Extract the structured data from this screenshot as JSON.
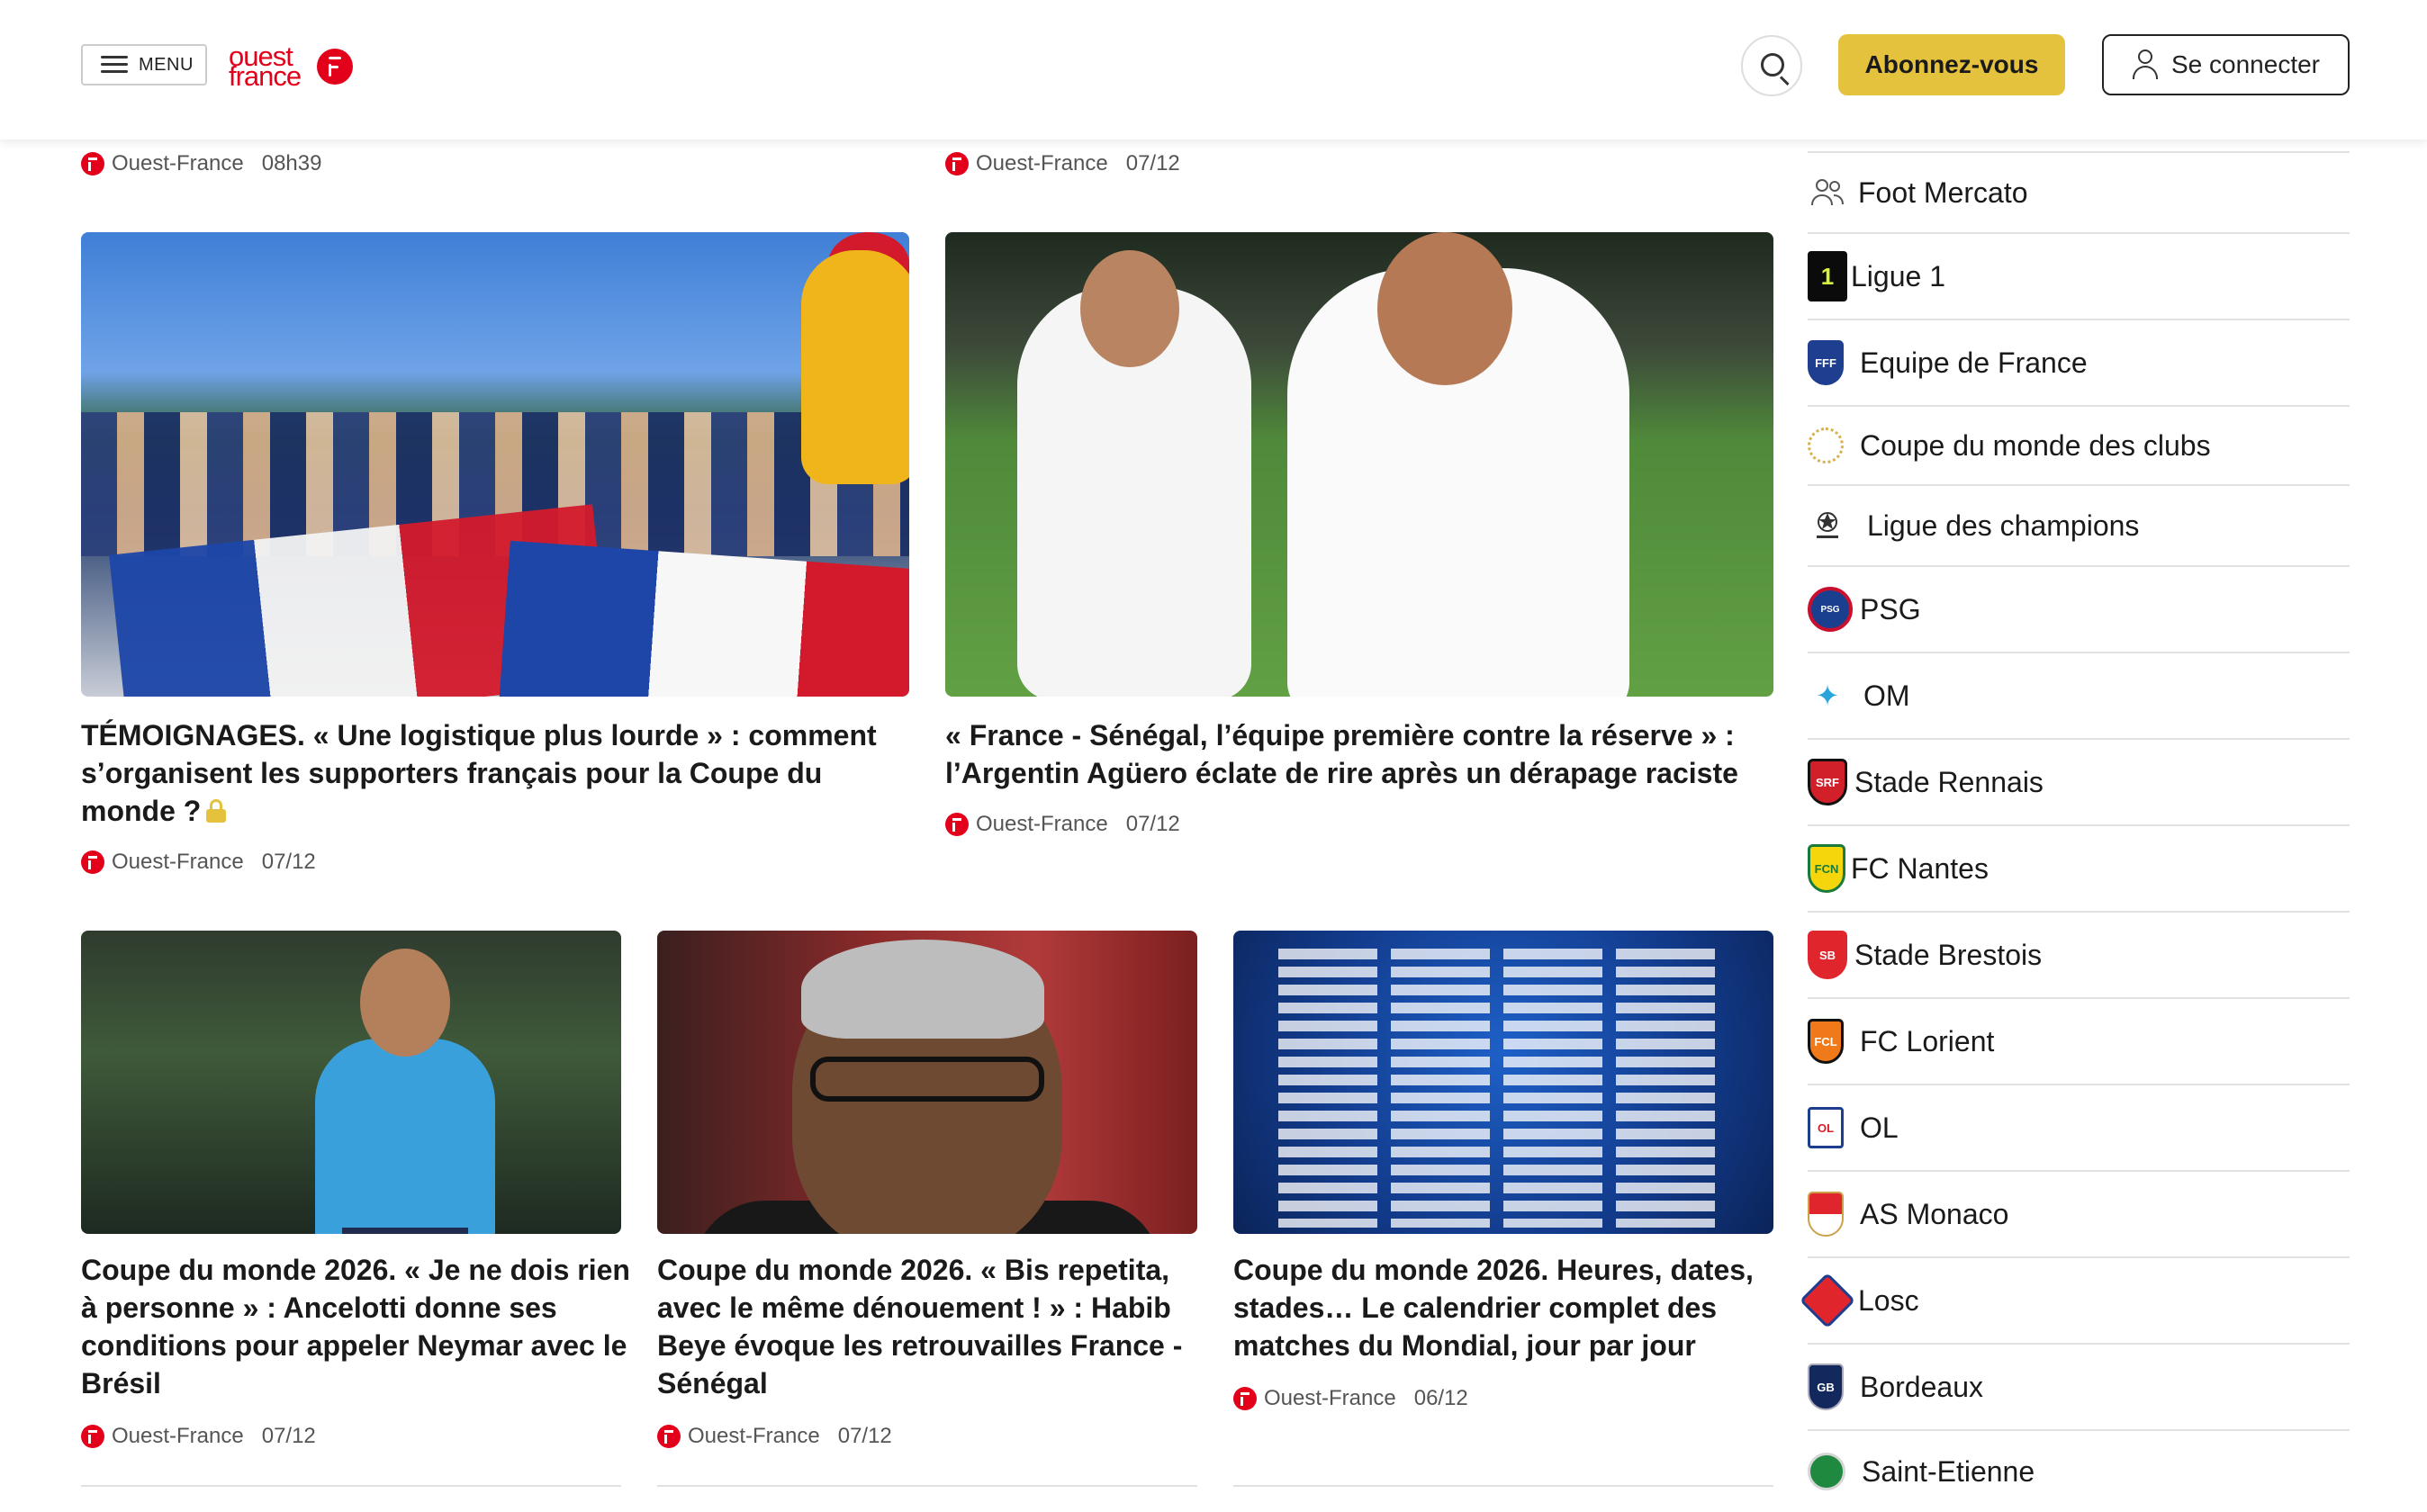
{
  "header": {
    "menu_label": "MENU",
    "logo_text": "ouest france",
    "subscribe_label": "Abonnez-vous",
    "login_label": "Se connecter"
  },
  "top_meta": [
    {
      "source": "Ouest-France",
      "time": "08h39"
    },
    {
      "source": "Ouest-France",
      "time": "07/12"
    }
  ],
  "articles": [
    {
      "title": "TÉMOIGNAGES. « Une logistique plus lourde » : comment s’organisent les supporters français pour la Coupe du monde ?",
      "source": "Ouest-France",
      "time": "07/12",
      "premium": true
    },
    {
      "title": "« France - Sénégal, l’équipe première contre la réserve » : l’Argentin Agüero éclate de rire après un dérapage raciste",
      "source": "Ouest-France",
      "time": "07/12"
    },
    {
      "title": "Coupe du monde 2026. « Je ne dois rien à personne » : Ancelotti donne ses conditions pour appeler Neymar avec le Brésil",
      "source": "Ouest-France",
      "time": "07/12"
    },
    {
      "title": "Coupe du monde 2026. « Bis repetita, avec le même dénouement ! » : Habib Beye évoque les retrouvailles France - Sénégal",
      "source": "Ouest-France",
      "time": "07/12"
    },
    {
      "title": "Coupe du monde 2026. Heures, dates, stades… Le calendrier complet des matches du Mondial, jour par jour",
      "source": "Ouest-France",
      "time": "06/12"
    }
  ],
  "sidebar": {
    "items": [
      {
        "label": "Foot Mercato",
        "icon": "users-icon"
      },
      {
        "label": "Ligue 1",
        "icon": "ligue1-logo-icon"
      },
      {
        "label": "Equipe de France",
        "icon": "fff-crest-icon"
      },
      {
        "label": "Coupe du monde des clubs",
        "icon": "club-world-cup-icon"
      },
      {
        "label": "Ligue des champions",
        "icon": "champions-league-icon"
      },
      {
        "label": "PSG",
        "icon": "psg-crest-icon"
      },
      {
        "label": "OM",
        "icon": "om-crest-icon"
      },
      {
        "label": "Stade Rennais",
        "icon": "rennes-crest-icon"
      },
      {
        "label": "FC Nantes",
        "icon": "nantes-crest-icon"
      },
      {
        "label": "Stade Brestois",
        "icon": "brest-crest-icon"
      },
      {
        "label": "FC Lorient",
        "icon": "lorient-crest-icon"
      },
      {
        "label": "OL",
        "icon": "ol-crest-icon"
      },
      {
        "label": "AS Monaco",
        "icon": "monaco-crest-icon"
      },
      {
        "label": "Losc",
        "icon": "losc-crest-icon"
      },
      {
        "label": "Bordeaux",
        "icon": "bordeaux-crest-icon"
      },
      {
        "label": "Saint-Etienne",
        "icon": "saint-etienne-crest-icon"
      }
    ]
  },
  "colors": {
    "brand_red": "#e2001a",
    "subscribe_yellow": "#e5c23d"
  }
}
